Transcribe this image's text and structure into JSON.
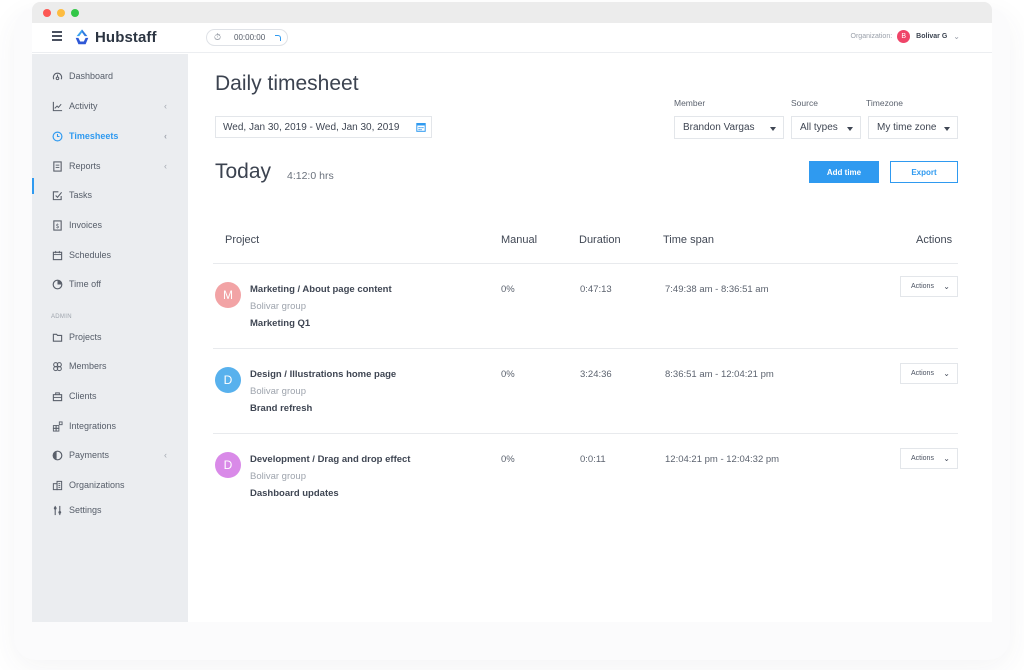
{
  "window": {
    "traffic_lights": [
      "close",
      "minimize",
      "maximize"
    ]
  },
  "topbar": {
    "menu_icon": "hamburger-icon",
    "logo_icon": "hubstaff-logo-icon",
    "app_name": "Hubstaff",
    "timer": {
      "icon": "stopwatch-icon",
      "value": "00:00:00",
      "status_icon": "loading-spinner-icon"
    },
    "organization": {
      "label": "Organization:",
      "avatar_initial": "B",
      "avatar_color": "#ef4468",
      "name": "Bolivar G",
      "chevron": "⌄"
    }
  },
  "sidebar": {
    "items": [
      {
        "label": "Dashboard",
        "icon": "dashboard-gauge-icon",
        "has_submenu": false,
        "active": false
      },
      {
        "label": "Activity",
        "icon": "activity-chart-icon",
        "has_submenu": true,
        "active": false
      },
      {
        "label": "Timesheets",
        "icon": "clock-icon",
        "has_submenu": true,
        "active": true
      },
      {
        "label": "Reports",
        "icon": "report-document-icon",
        "has_submenu": true,
        "active": false
      },
      {
        "label": "Tasks",
        "icon": "task-checkbox-icon",
        "has_submenu": false,
        "active": false
      },
      {
        "label": "Invoices",
        "icon": "invoice-dollar-icon",
        "has_submenu": false,
        "active": false
      },
      {
        "label": "Schedules",
        "icon": "calendar-icon",
        "has_submenu": false,
        "active": false
      },
      {
        "label": "Time off",
        "icon": "pie-clock-icon",
        "has_submenu": false,
        "active": false
      }
    ],
    "admin_label": "ADMIN",
    "admin_items": [
      {
        "label": "Projects",
        "icon": "folder-icon",
        "has_submenu": false
      },
      {
        "label": "Members",
        "icon": "members-group-icon",
        "has_submenu": false
      },
      {
        "label": "Clients",
        "icon": "briefcase-icon",
        "has_submenu": false
      },
      {
        "label": "Integrations",
        "icon": "integrations-blocks-icon",
        "has_submenu": false
      },
      {
        "label": "Payments",
        "icon": "payments-coin-icon",
        "has_submenu": true
      },
      {
        "label": "Organizations",
        "icon": "organization-building-icon",
        "has_submenu": false
      },
      {
        "label": "Settings",
        "icon": "settings-sliders-icon",
        "has_submenu": false
      }
    ],
    "submenu_chevron": "‹"
  },
  "main": {
    "title": "Daily timesheet",
    "date_range": {
      "value": "Wed, Jan 30, 2019 - Wed, Jan 30, 2019",
      "icon": "calendar-icon"
    },
    "filters": {
      "member": {
        "label": "Member",
        "value": "Brandon Vargas"
      },
      "source": {
        "label": "Source",
        "value": "All types"
      },
      "timezone": {
        "label": "Timezone",
        "value": "My time zone"
      }
    },
    "today_label": "Today",
    "total_hours": "4:12:0 hrs",
    "add_time_label": "Add time",
    "export_label": "Export",
    "table": {
      "headers": {
        "project": "Project",
        "manual": "Manual",
        "duration": "Duration",
        "time_span": "Time span",
        "actions": "Actions"
      },
      "rows": [
        {
          "avatar_initial": "M",
          "avatar_color": "#f2a3a5",
          "project": "Marketing / About page content",
          "group": "Bolivar group",
          "task": "Marketing Q1",
          "manual": "0%",
          "duration": "0:47:13",
          "time_span": "7:49:38 am - 8:36:51 am",
          "action_label": "Actions"
        },
        {
          "avatar_initial": "D",
          "avatar_color": "#58b1ed",
          "project": "Design / Illustrations home page",
          "group": "Bolivar group",
          "task": "Brand refresh",
          "manual": "0%",
          "duration": "3:24:36",
          "time_span": "8:36:51 am - 12:04:21 pm",
          "action_label": "Actions"
        },
        {
          "avatar_initial": "D",
          "avatar_color": "#d98ae8",
          "project": "Development / Drag and drop effect",
          "group": "Bolivar group",
          "task": "Dashboard updates",
          "manual": "0%",
          "duration": "0:0:11",
          "time_span": "12:04:21 pm - 12:04:32 pm",
          "action_label": "Actions"
        }
      ]
    }
  },
  "colors": {
    "accent": "#2f9af0",
    "sidebar_bg": "#ebedf0",
    "text_primary": "#3c4350",
    "text_muted": "#9ea4ad"
  }
}
